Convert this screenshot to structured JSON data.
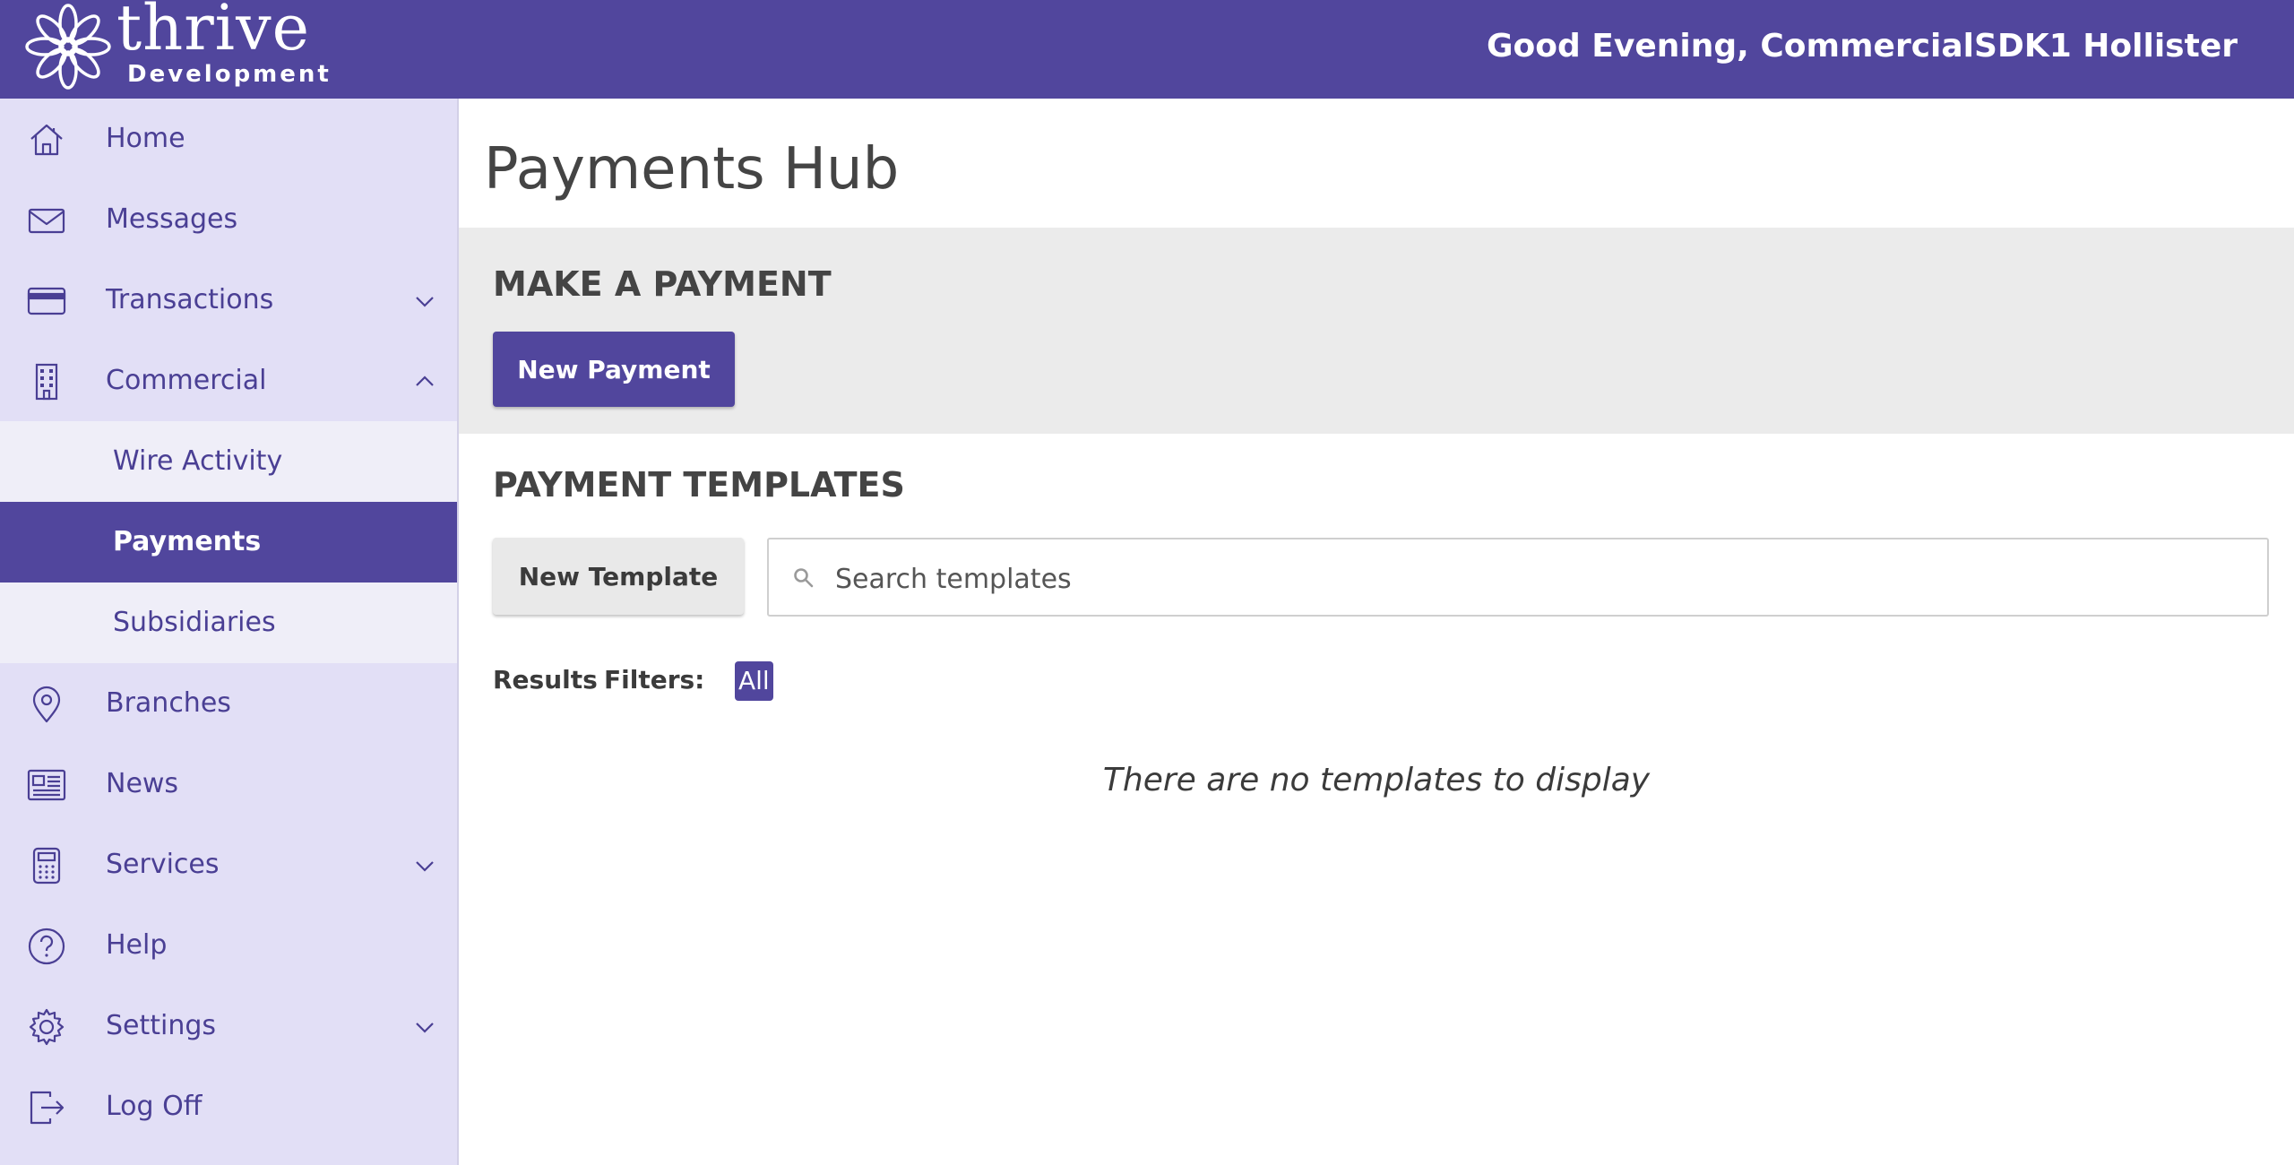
{
  "header": {
    "logo_word": "thrive",
    "logo_sub": "Development",
    "greeting": "Good Evening, CommercialSDK1 Hollister",
    "background_color": "#51469d"
  },
  "sidebar": {
    "items": [
      {
        "label": "Home",
        "icon": "home-icon"
      },
      {
        "label": "Messages",
        "icon": "envelope-icon"
      },
      {
        "label": "Transactions",
        "icon": "credit-card-icon",
        "chevron": "down"
      },
      {
        "label": "Commercial",
        "icon": "building-icon",
        "chevron": "up",
        "expanded": true
      },
      {
        "label": "Branches",
        "icon": "map-pin-icon"
      },
      {
        "label": "News",
        "icon": "newspaper-icon"
      },
      {
        "label": "Services",
        "icon": "calculator-icon",
        "chevron": "down"
      },
      {
        "label": "Help",
        "icon": "help-circle-icon"
      },
      {
        "label": "Settings",
        "icon": "gear-icon",
        "chevron": "down"
      },
      {
        "label": "Log Off",
        "icon": "logout-icon"
      }
    ],
    "commercial_subitems": [
      {
        "label": "Wire Activity"
      },
      {
        "label": "Payments",
        "active": true
      },
      {
        "label": "Subsidiaries"
      }
    ],
    "background_color": "#e2dff6",
    "active_color": "#51469d"
  },
  "main": {
    "page_title": "Payments Hub",
    "make_payment": {
      "heading": "MAKE A PAYMENT",
      "new_payment_label": "New Payment"
    },
    "templates": {
      "heading": "PAYMENT TEMPLATES",
      "new_template_label": "New Template",
      "search_placeholder": "Search templates",
      "search_value": "",
      "results_label": "Results",
      "filters_label": "Filters:",
      "filter_all": "All",
      "empty_message": "There are no templates to display"
    }
  }
}
